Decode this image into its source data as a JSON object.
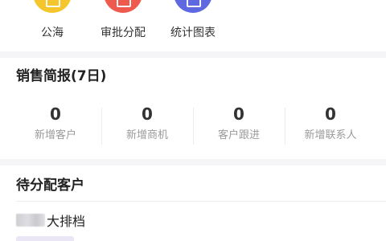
{
  "quick_actions": [
    {
      "label": "公海",
      "icon": "sea-icon",
      "color": "#f5c52c"
    },
    {
      "label": "审批分配",
      "icon": "approve-icon",
      "color": "#ef5a4f"
    },
    {
      "label": "统计图表",
      "icon": "chart-icon",
      "color": "#5e68e0"
    }
  ],
  "sales_report": {
    "title": "销售简报(7日)",
    "stats": [
      {
        "value": "0",
        "label": "新增客户"
      },
      {
        "value": "0",
        "label": "新增商机"
      },
      {
        "value": "0",
        "label": "客户跟进"
      },
      {
        "value": "0",
        "label": "新增联系人"
      }
    ]
  },
  "pending_customers": {
    "title": "待分配客户",
    "items": [
      {
        "name": "大排档"
      }
    ]
  }
}
